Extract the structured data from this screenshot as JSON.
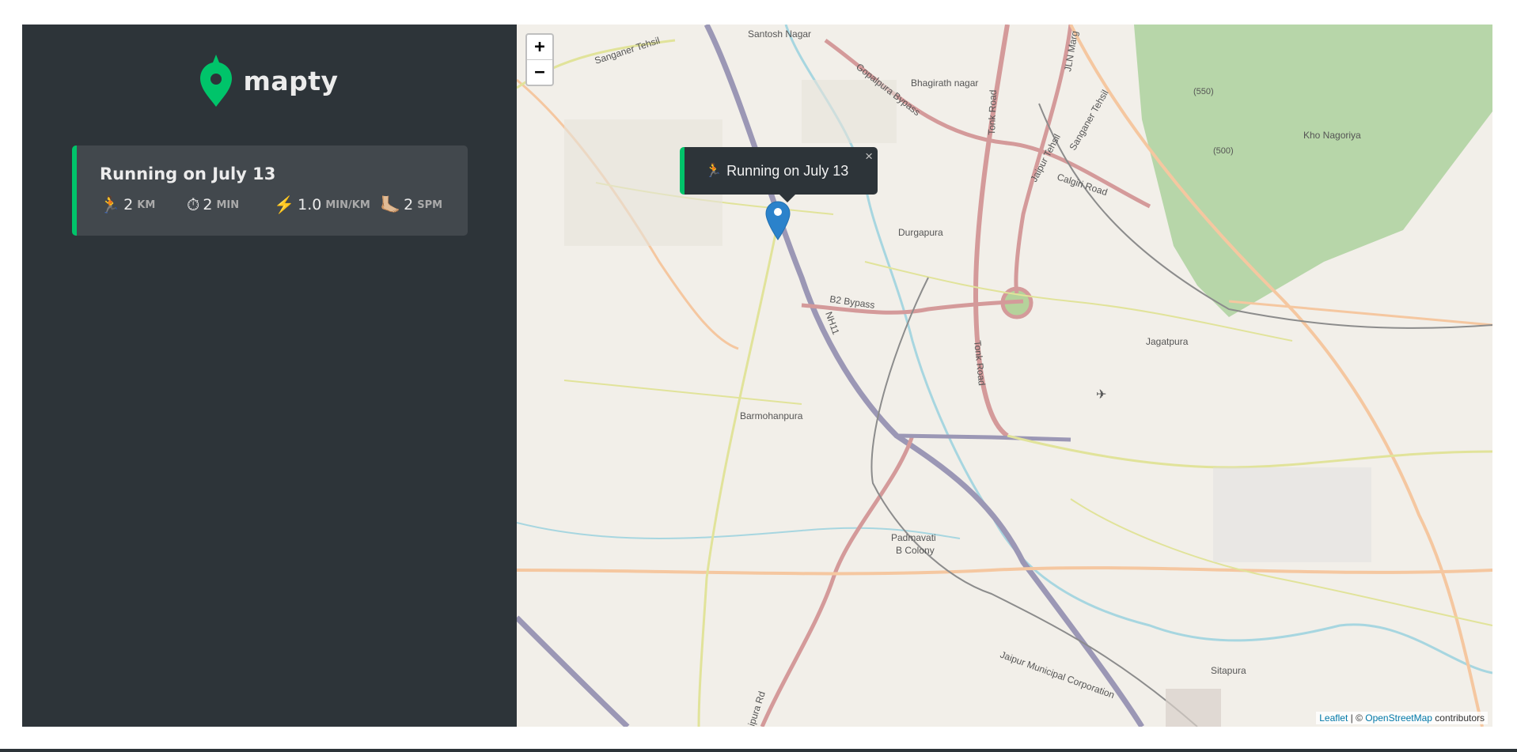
{
  "app": {
    "name": "mapty"
  },
  "workout": {
    "title": "Running on July 13",
    "type_icon": "🏃",
    "stats": [
      {
        "icon": "🏃",
        "icon_name": "running-icon",
        "value": "2",
        "unit": "km"
      },
      {
        "icon": "⏱",
        "icon_name": "stopwatch-icon",
        "value": "2",
        "unit": "min"
      },
      {
        "icon": "⚡️",
        "icon_name": "lightning-icon",
        "value": "1.0",
        "unit": "min/km"
      },
      {
        "icon": "🦶🏼",
        "icon_name": "foot-icon",
        "value": "2",
        "unit": "spm"
      }
    ],
    "accent_color": "#00c46a"
  },
  "map": {
    "zoom_in": "+",
    "zoom_out": "−",
    "popup": {
      "icon": "🏃",
      "text": "Running on July 13",
      "close": "×"
    },
    "labels": {
      "santosh_nagar": "Santosh Nagar",
      "sanganer_tehsil": "Sanganer Tehsil",
      "gopalpura_bypass": "Gopalpura Bypass",
      "bhagirath_nagar": "Bhagirath nagar",
      "tonk_road": "Tonk Road",
      "jln_marg": "JLN Marg",
      "jaipur_tehsil": "Jaipur Tehsil",
      "sanganer_tehsil2": "Sanganer Tehsil",
      "calgiri_road": "Calgiri Road",
      "elev_550": "(550)",
      "elev_500": "(500)",
      "kho_nagoriya": "Kho Nagoriya",
      "durgapura": "Durgapura",
      "b2_bypass": "B2 Bypass",
      "nh11": "NH11",
      "tonk_road2": "Tonk Road",
      "jagatpura": "Jagatpura",
      "barmohanpura": "Barmohanpura",
      "padmavati": "Padmavati",
      "b_colony": "B Colony",
      "jmc": "Jaipur Municipal Corporation",
      "sitapura": "Sitapura",
      "ipura_rd": "ipura Rd"
    },
    "attribution": {
      "leaflet": "Leaflet",
      "sep": " | © ",
      "osm": "OpenStreetMap",
      "contributors": " contributors"
    }
  }
}
